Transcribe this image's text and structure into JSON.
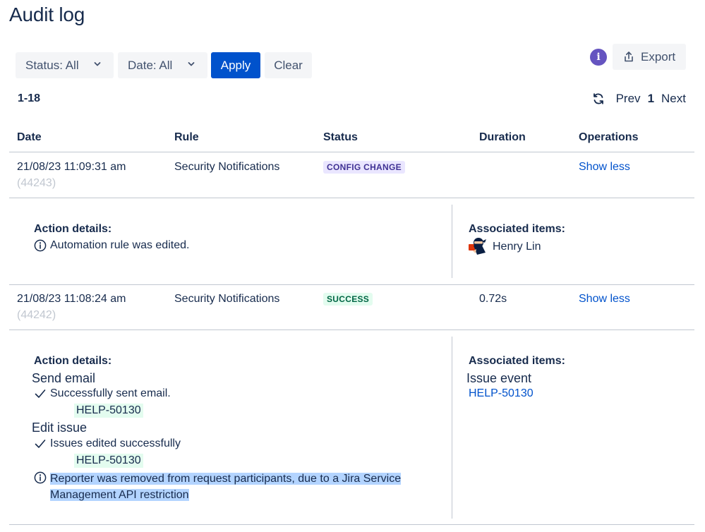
{
  "page": {
    "title": "Audit log"
  },
  "filters": {
    "status_label": "Status: All",
    "date_label": "Date: All",
    "apply_label": "Apply",
    "clear_label": "Clear"
  },
  "toolbar": {
    "info_glyph": "i",
    "export_label": "Export"
  },
  "pagination": {
    "range": "1-18",
    "prev": "Prev",
    "current": "1",
    "next": "Next"
  },
  "table": {
    "headers": {
      "date": "Date",
      "rule": "Rule",
      "status": "Status",
      "duration": "Duration",
      "operations": "Operations"
    },
    "rows": [
      {
        "date": "21/08/23 11:09:31 am",
        "id": "(44243)",
        "rule": "Security Notifications",
        "status": "CONFIG CHANGE",
        "duration": "",
        "operation": "Show less",
        "details": {
          "action_heading": "Action details:",
          "message": "Automation rule was edited.",
          "associated_heading": "Associated items:",
          "user": "Henry Lin"
        }
      },
      {
        "date": "21/08/23 11:08:24 am",
        "id": "(44242)",
        "rule": "Security Notifications",
        "status": "SUCCESS",
        "duration": "0.72s",
        "operation": "Show less",
        "details": {
          "action_heading": "Action details:",
          "actions": [
            {
              "name": "Send email",
              "result": "Successfully sent email.",
              "issue": "HELP-50130"
            },
            {
              "name": "Edit issue",
              "result": "Issues edited successfully",
              "issue": "HELP-50130"
            }
          ],
          "note_line1": "Reporter was removed from request participants, due to a Jira Service",
          "note_line2": "Management API restriction",
          "associated_heading": "Associated items:",
          "associated_type": "Issue event",
          "associated_link": "HELP-50130"
        }
      }
    ]
  },
  "colors": {
    "primary": "#0052cc",
    "text": "#172b4d",
    "config_lozenge_bg": "#eae6ff",
    "success_lozenge_bg": "#e3fcef",
    "info_badge": "#6554c0",
    "selection": "#b3d4ff"
  },
  "icons": [
    "chevron-down-icon",
    "info-badge-icon",
    "export-icon",
    "refresh-icon",
    "info-circle-icon",
    "check-icon",
    "user-avatar"
  ]
}
